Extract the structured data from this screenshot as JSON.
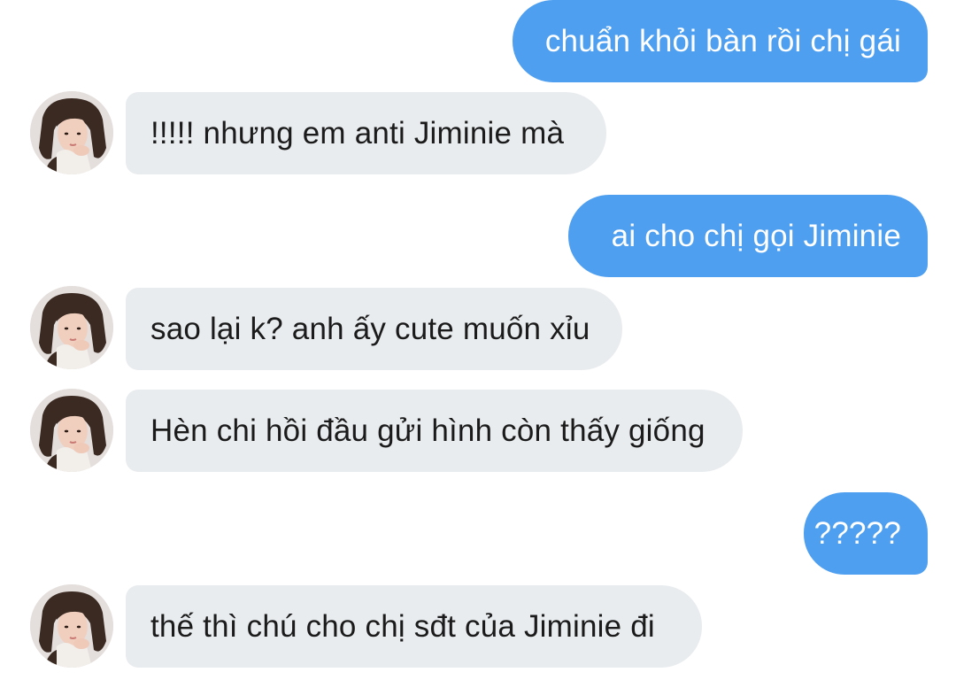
{
  "conversation": {
    "messages": [
      {
        "direction": "outgoing",
        "text": "chuẩn khỏi bàn rồi chị gái"
      },
      {
        "direction": "incoming",
        "text": "!!!!! nhưng em anti Jiminie mà",
        "avatar": "contact-avatar"
      },
      {
        "direction": "outgoing",
        "text": "ai cho chị gọi Jiminie"
      },
      {
        "direction": "incoming",
        "text": "sao lại k? anh ấy cute muốn xỉu",
        "avatar": "contact-avatar"
      },
      {
        "direction": "incoming",
        "text": "Hèn chi hồi đầu gửi hình còn thấy giống",
        "avatar": "contact-avatar"
      },
      {
        "direction": "outgoing",
        "text": "?????"
      },
      {
        "direction": "incoming",
        "text": "thế thì chú cho chị sđt của Jiminie đi",
        "avatar": "contact-avatar"
      }
    ]
  },
  "colors": {
    "outgoing_bubble": "#4f9ff0",
    "incoming_bubble": "#e9ecef",
    "background": "#ffffff"
  }
}
